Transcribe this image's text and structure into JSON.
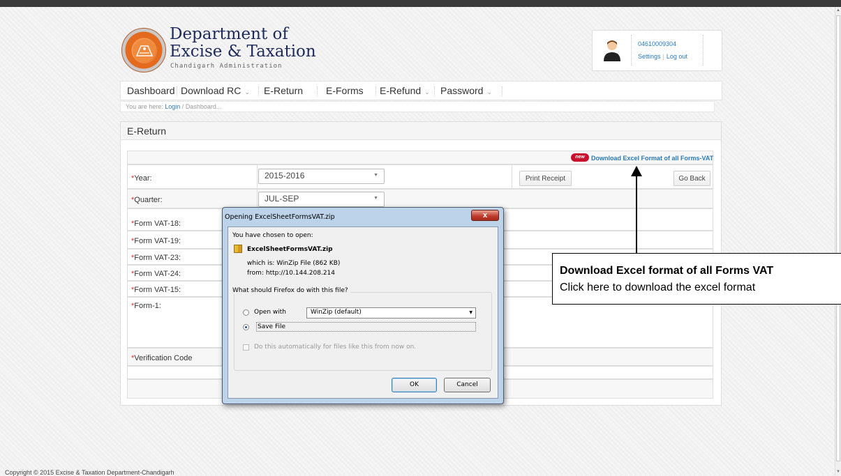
{
  "header": {
    "title_line1": "Department of",
    "title_line2": "Excise & Taxation",
    "subtitle": "Chandigarh Administration"
  },
  "user": {
    "id": "04610009304",
    "settings_label": "Settings",
    "logout_label": "Log out"
  },
  "nav": {
    "items": [
      {
        "label": "Dashboard"
      },
      {
        "label": "Download RC"
      },
      {
        "label": "E-Return"
      },
      {
        "label": "E-Forms"
      },
      {
        "label": "E-Refund"
      },
      {
        "label": "Password"
      }
    ]
  },
  "breadcrumb": {
    "prefix": "You are here:",
    "login": "Login",
    "separator": "/",
    "current": "Dashboard..."
  },
  "panel": {
    "title": "E-Return",
    "new_badge": "new",
    "download_link": "Download Excel Format of all Forms-VAT",
    "required_mark": "*",
    "fields": {
      "year": "Year:",
      "quarter": "Quarter:",
      "vat18": "Form VAT-18:",
      "vat19": "Form VAT-19:",
      "vat23": "Form VAT-23:",
      "vat24": "Form VAT-24:",
      "vat15": "Form VAT-15:",
      "form1": "Form-1:",
      "verification": "Verification Code"
    },
    "year_value": "2015-2016",
    "quarter_value": "JUL-SEP",
    "print_receipt": "Print Receipt",
    "go_back": "Go Back"
  },
  "dialog": {
    "title": "Opening ExcelSheetFormsVAT.zip",
    "close": "x",
    "chosen_text": "You have chosen to open:",
    "file_name": "ExcelSheetFormsVAT.zip",
    "which_is_label": "which is:",
    "which_is_value": "WinZip File (862 KB)",
    "from_label": "from:",
    "from_value": "http://10.144.208.214",
    "question": "What should Firefox do with this file?",
    "open_with_label": "Open with",
    "open_with_app": "WinZip (default)",
    "save_file_label": "Save File",
    "auto_label": "Do this automatically for files like this from now on.",
    "ok": "OK",
    "cancel": "Cancel"
  },
  "callout": {
    "heading": "Download Excel format of all Forms VAT",
    "body": "Click here to download the excel format"
  },
  "footer": {
    "copyright": "Copyright © 2015 Excise & Taxation Department-Chandigarh"
  }
}
